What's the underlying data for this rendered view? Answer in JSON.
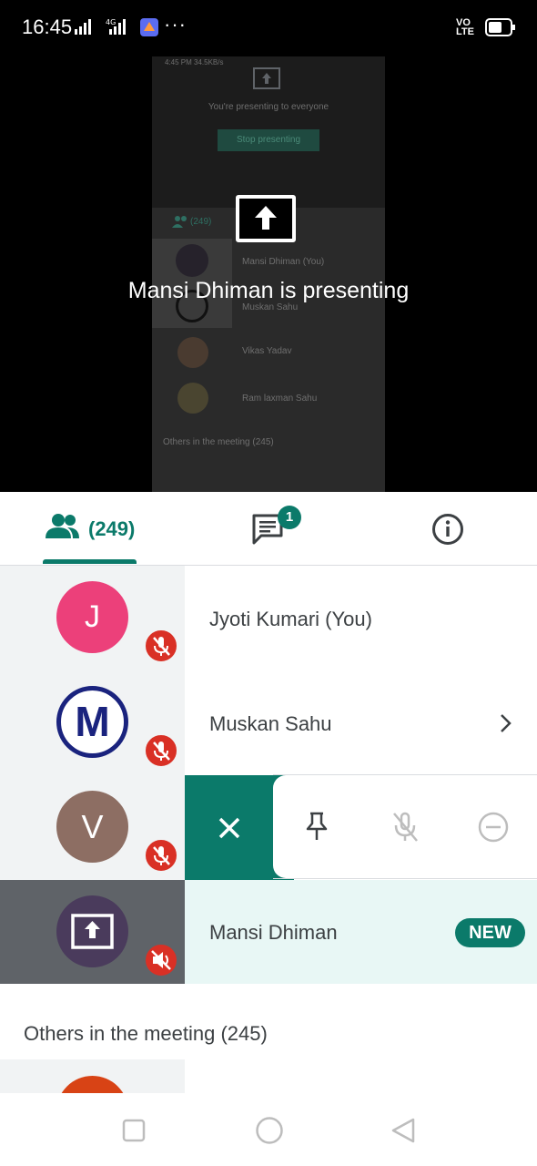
{
  "status_bar": {
    "time": "16:45",
    "more": "···",
    "volte": "VO\nLTE"
  },
  "stage": {
    "presenting_text": "Mansi Dhiman is presenting",
    "mirror": {
      "top_text": "4:45 PM 34.5KB/s",
      "presenting_to_everyone": "You're presenting to everyone",
      "stop_presenting": "Stop presenting",
      "people_count": "(249)",
      "participants": [
        "Mansi Dhiman (You)",
        "Muskan Sahu",
        "Vikas Yadav",
        "Ram laxman Sahu"
      ],
      "others": "Others in the meeting (245)"
    }
  },
  "tabs": {
    "people_label": "(249)",
    "chat_badge": "1"
  },
  "participants": [
    {
      "name": "Jyoti Kumari (You)",
      "initial": "J",
      "color": "#ec407a"
    },
    {
      "name": "Muskan Sahu",
      "initial": "M",
      "color": "#1a237e"
    },
    {
      "name": "",
      "initial": "V",
      "color": "#8d6e63"
    },
    {
      "name": "Mansi Dhiman",
      "initial": "",
      "color": "#4a3b5c",
      "badge": "NEW"
    }
  ],
  "others_heading": "Others in the meeting (245)",
  "colors": {
    "accent": "#0b7a6a",
    "mute_red": "#d93025",
    "highlight_row": "#e8f7f5"
  }
}
